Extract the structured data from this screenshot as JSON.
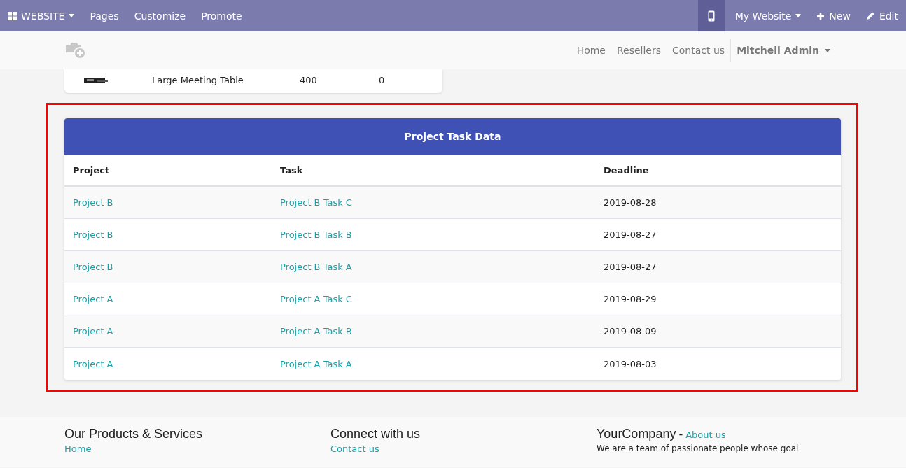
{
  "topbar": {
    "app_menu": "WEBSITE",
    "menu": [
      "Pages",
      "Customize",
      "Promote"
    ],
    "website_menu": "My Website",
    "new": "New",
    "edit": "Edit"
  },
  "header": {
    "nav": [
      {
        "label": "Home",
        "selected": false
      },
      {
        "label": "Resellers",
        "selected": false
      },
      {
        "label": "Contact us",
        "selected": false
      }
    ],
    "user": "Mitchell Admin"
  },
  "previous_card": {
    "row": [
      "Large Meeting Table",
      "400",
      "0"
    ]
  },
  "task_table": {
    "title": "Project Task Data",
    "columns": [
      "Project",
      "Task",
      "Deadline"
    ],
    "rows": [
      {
        "project": "Project B",
        "task": "Project B Task C",
        "deadline": "2019-08-28"
      },
      {
        "project": "Project B",
        "task": "Project B Task B",
        "deadline": "2019-08-27"
      },
      {
        "project": "Project B",
        "task": "Project B Task A",
        "deadline": "2019-08-27"
      },
      {
        "project": "Project A",
        "task": "Project A Task C",
        "deadline": "2019-08-29"
      },
      {
        "project": "Project A",
        "task": "Project A Task B",
        "deadline": "2019-08-09"
      },
      {
        "project": "Project A",
        "task": "Project A Task A",
        "deadline": "2019-08-03"
      }
    ]
  },
  "footer": [
    {
      "heading": "Our Products & Services",
      "link": "Home"
    },
    {
      "heading": "Connect with us",
      "link": "Contact us"
    },
    {
      "heading": "YourCompany",
      "separator": "-",
      "heading_link": "About us",
      "text": "We are a team of passionate people whose goal"
    }
  ]
}
